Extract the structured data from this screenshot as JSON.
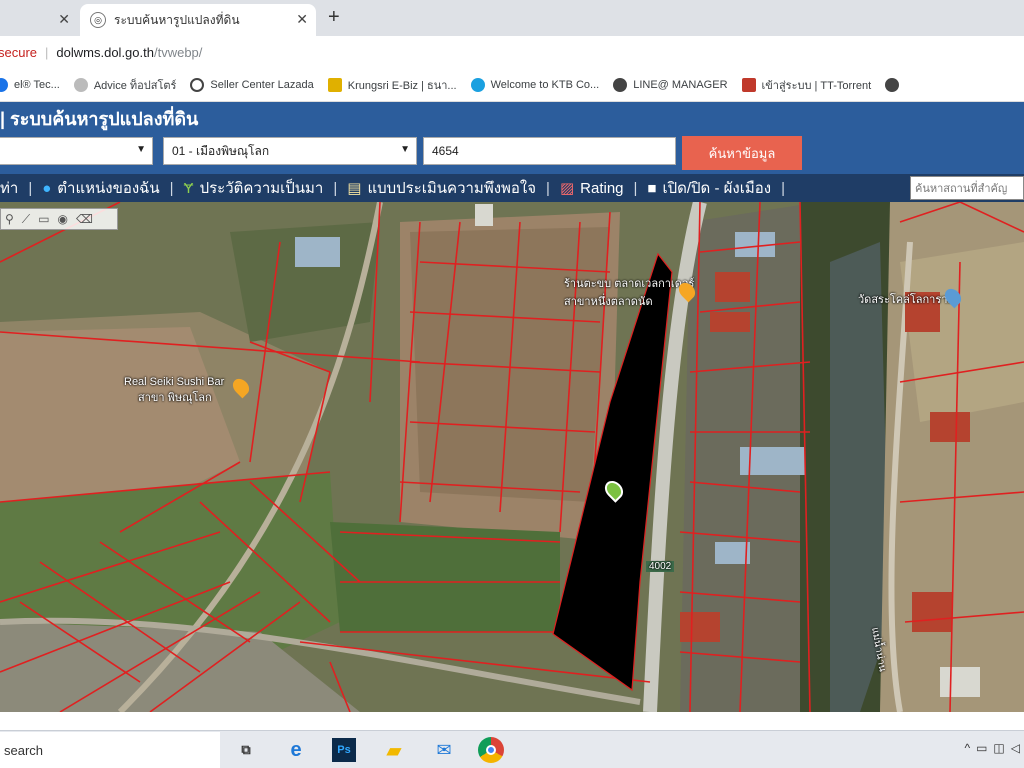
{
  "browser": {
    "tab1_close": "✕",
    "tab2_title": "ระบบค้นหารูปแปลงที่ดิน",
    "tab2_close": "✕",
    "new_tab": "+",
    "security": "secure",
    "url_host": "dolwms.dol.go.th",
    "url_path": "/tvwebp/"
  },
  "bookmarks": [
    {
      "label": "el® Tec...",
      "color": "#1a73e8"
    },
    {
      "label": "Advice ท็อปสโตร์",
      "color": "#999999"
    },
    {
      "label": "Seller Center Lazada",
      "color": "#444444"
    },
    {
      "label": "Krungsri E-Biz | ธนา...",
      "color": "#e0b000"
    },
    {
      "label": "Welcome to KTB Co...",
      "color": "#1aa0e0"
    },
    {
      "label": "LINE@ MANAGER",
      "color": "#444444"
    },
    {
      "label": "เข้าสู่ระบบ | TT-Torrent",
      "color": "#c0392b"
    }
  ],
  "app": {
    "title": "| ระบบค้นหารูปแปลงที่ดิน",
    "select_district": "01 - เมืองพิษณุโลก",
    "parcel_number": "4654",
    "search_button": "ค้นหาข้อมูล",
    "search_place_placeholder": "ค้นหาสถานที่สำคัญ"
  },
  "menu": [
    {
      "label": "ท่า"
    },
    {
      "label": "ตำแหน่งของฉัน"
    },
    {
      "label": "ประวัติความเป็นมา"
    },
    {
      "label": "แบบประเมินความพึงพอใจ"
    },
    {
      "label": "Rating"
    },
    {
      "label": "เปิด/ปิด - ผังเมือง"
    }
  ],
  "map": {
    "label_sushi": "Real Seiki Sushi Bar",
    "label_sushi2": "สาขา พิษณุโลก",
    "label_shop": "ร้านตะขบ ตลาดเวลกาเดอร์",
    "label_shop2": "สาขาหนึ่งตลาดนัด",
    "label_temple": "วัดสระโคล่โลการาม",
    "label_road": "4002",
    "label_river": "แม่น้ำน่าน"
  },
  "taskbar": {
    "search": "search"
  },
  "colors": {
    "header": "#2c5d9c",
    "menubar": "#1f3d66",
    "button": "#e8634f",
    "parcel_line": "#e02020",
    "selected_parcel": "#000000"
  }
}
